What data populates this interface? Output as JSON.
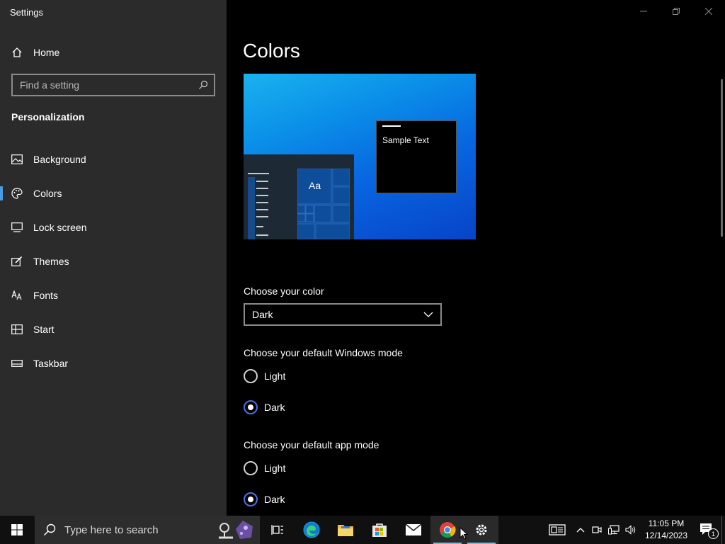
{
  "window": {
    "title": "Settings",
    "controls": [
      "minimize-icon",
      "restore-icon",
      "close-icon"
    ]
  },
  "sidebar": {
    "home_label": "Home",
    "search_placeholder": "Find a setting",
    "section_title": "Personalization",
    "items": [
      {
        "label": "Background",
        "icon": "background-image-icon",
        "active": false
      },
      {
        "label": "Colors",
        "icon": "palette-icon",
        "active": true
      },
      {
        "label": "Lock screen",
        "icon": "lock-screen-icon",
        "active": false
      },
      {
        "label": "Themes",
        "icon": "themes-brush-icon",
        "active": false
      },
      {
        "label": "Fonts",
        "icon": "fonts-icon",
        "active": false
      },
      {
        "label": "Start",
        "icon": "start-grid-icon",
        "active": false
      },
      {
        "label": "Taskbar",
        "icon": "taskbar-icon",
        "active": false
      }
    ]
  },
  "main": {
    "title": "Colors",
    "preview": {
      "sample_text": "Sample Text",
      "tile_text": "Aa"
    },
    "choose_color_label": "Choose your color",
    "choose_color_value": "Dark",
    "windows_mode": {
      "label": "Choose your default Windows mode",
      "options": [
        "Light",
        "Dark"
      ],
      "selected": "Dark"
    },
    "app_mode": {
      "label": "Choose your default app mode",
      "options": [
        "Light",
        "Dark"
      ],
      "selected": "Dark"
    }
  },
  "taskbar": {
    "search_placeholder": "Type here to search",
    "time": "11:05 PM",
    "date": "12/14/2023",
    "notification_count": "1",
    "accent": "#76b9ed"
  }
}
